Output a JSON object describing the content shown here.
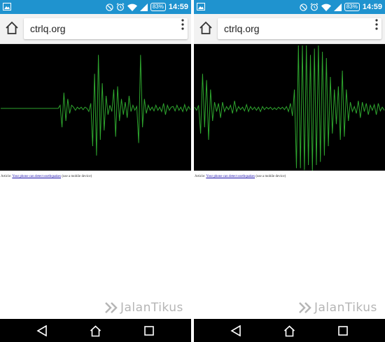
{
  "screens": [
    {
      "status": {
        "battery": "83%",
        "time": "14:59",
        "left_icon": "image-notification-icon"
      },
      "toolbar": {
        "url": "ctrlq.org",
        "home_icon": "home-icon",
        "menu_icon": "overflow-menu-icon"
      },
      "article": {
        "prefix": "Article: ",
        "link": "Your phone can detect earthquakes",
        "suffix": " (use a mobile device)"
      },
      "seismograph": {
        "color": "#2ea52e",
        "samples": [
          0,
          0,
          0,
          0,
          0,
          0,
          0,
          0,
          0,
          0,
          0,
          0,
          0,
          0,
          0,
          0,
          0,
          0,
          0,
          0,
          0,
          0,
          0,
          0,
          0,
          0,
          0,
          0,
          0,
          0,
          0,
          0.05,
          -0.3,
          0.25,
          -0.2,
          0.15,
          -0.08,
          0.05,
          0.02,
          -0.03,
          0.02,
          -0.01,
          0.02,
          -0.02,
          0.02,
          0.0,
          -0.05,
          0.08,
          -0.6,
          0.55,
          -0.75,
          0.85,
          -0.5,
          0.4,
          -0.35,
          0.2,
          -0.1,
          0.05,
          -0.05,
          0.3,
          -0.45,
          0.35,
          -0.2,
          0.15,
          -0.1,
          0.1,
          -0.15,
          0.2,
          -0.05,
          0.05,
          -0.03,
          0.03,
          -0.55,
          0.85,
          -0.3,
          0.15,
          -0.08,
          0.05,
          -0.03,
          0.02,
          -0.04,
          0.05,
          -0.03,
          0.02,
          -0.05,
          0.08,
          -0.1,
          0.05,
          -0.03,
          0.02,
          0.03,
          -0.04,
          0.05,
          -0.03,
          0.02,
          -0.05,
          0.06,
          -0.04,
          0.03,
          -0.02
        ]
      }
    },
    {
      "status": {
        "battery": "83%",
        "time": "14:59",
        "left_icon": "image-notification-icon"
      },
      "toolbar": {
        "url": "ctrlq.org",
        "home_icon": "home-icon",
        "menu_icon": "overflow-menu-icon"
      },
      "article": {
        "prefix": "Article: ",
        "link": "Your phone can detect earthquakes",
        "suffix": " (use a mobile device)"
      },
      "seismograph": {
        "color": "#2ea52e",
        "samples": [
          0.02,
          -0.03,
          0.05,
          -0.4,
          0.55,
          -0.3,
          0.45,
          -0.5,
          0.3,
          -0.2,
          0.1,
          -0.05,
          0.08,
          -0.15,
          0.1,
          -0.05,
          0.03,
          -0.02,
          0.05,
          -0.08,
          0.12,
          -0.05,
          0.03,
          -0.02,
          0.02,
          -0.04,
          0.06,
          -0.05,
          0.03,
          -0.02,
          0.02,
          -0.03,
          0.02,
          -0.05,
          0.03,
          -0.02,
          0.02,
          -0.01,
          0.02,
          -0.02,
          0.01,
          -0.02,
          0.02,
          -0.01,
          0.02,
          -0.02,
          0.03,
          -0.05,
          0.08,
          -0.12,
          0.3,
          -0.95,
          1.0,
          -0.95,
          1.0,
          -0.98,
          1.0,
          -0.9,
          0.85,
          -1.0,
          0.95,
          -0.9,
          1.0,
          -0.85,
          0.9,
          -0.75,
          0.8,
          -0.6,
          0.5,
          -0.4,
          0.3,
          -0.25,
          0.35,
          -0.5,
          0.6,
          -0.45,
          0.3,
          -0.2,
          0.1,
          -0.05,
          0.03,
          -0.08,
          0.12,
          -0.15,
          0.1,
          -0.05,
          0.08,
          -0.1,
          0.05,
          -0.03,
          0.06,
          -0.1,
          0.08,
          -0.04,
          0.02,
          -0.03
        ]
      }
    }
  ],
  "watermark": {
    "text": "JalanTikus",
    "logo_icon": "double-chevron-logo-icon"
  },
  "nav": {
    "back_icon": "back-icon",
    "home_icon": "nav-home-icon",
    "recents_icon": "recents-icon"
  }
}
